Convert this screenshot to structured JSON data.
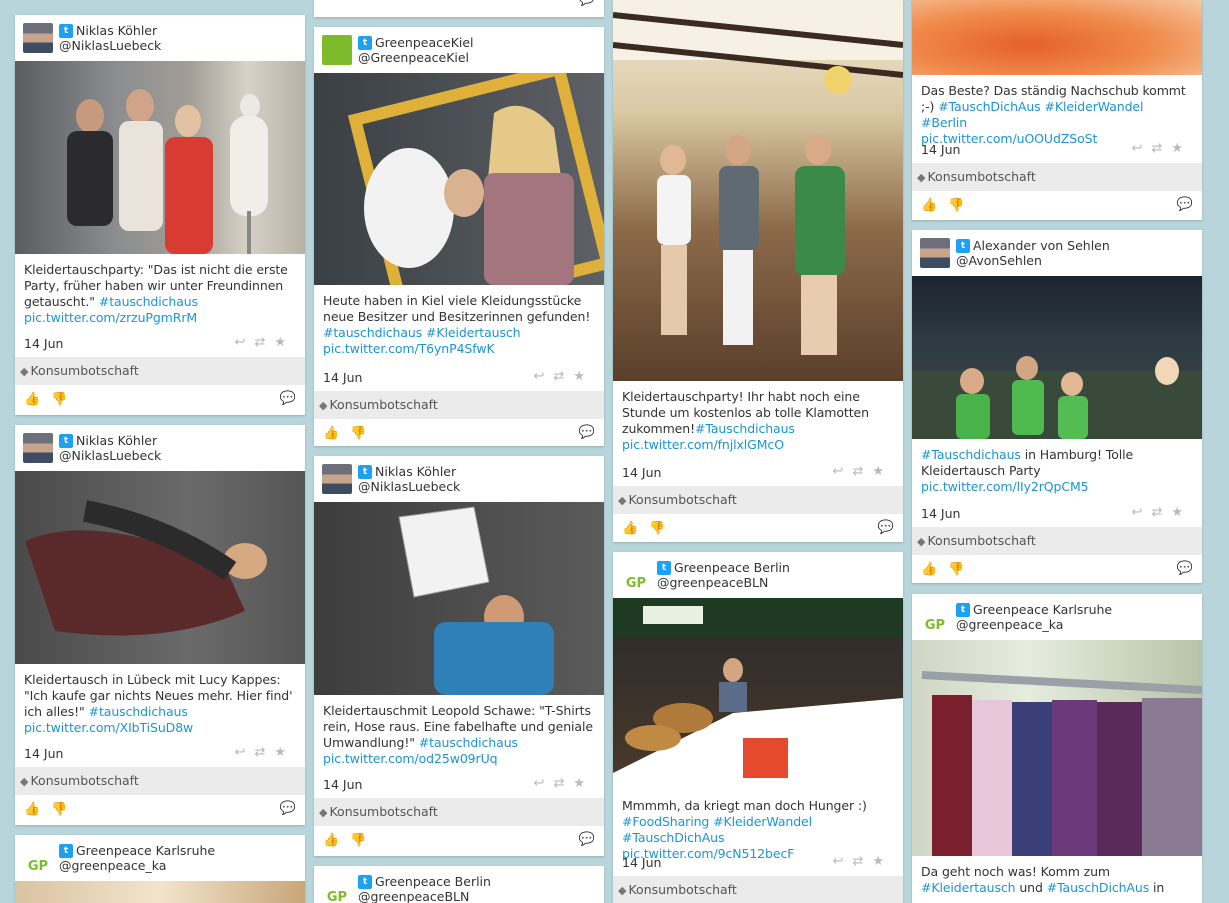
{
  "colors": {
    "background": "#b7d5da",
    "link": "#1b95d0",
    "tagbar": "#ebebeb",
    "twitter": "#1da1f2"
  },
  "icons": {
    "twitter": "twitter-icon",
    "tag": "tag-icon",
    "reply": "reply-icon",
    "retweet": "retweet-icon",
    "favorite": "star-icon",
    "like": "thumbs-up-icon",
    "dislike": "thumbs-down-icon",
    "comment": "comment-icon"
  },
  "tag_label": "Konsumbotschaft",
  "glyphs": {
    "tw": "t",
    "tag": "◆",
    "acts": "↩⇄★",
    "up": "👍",
    "down": "👎",
    "comment": "💬",
    "gp": "GP"
  },
  "posts": [
    {
      "user": "Niklas Köhler",
      "handle": "@NiklasLuebeck",
      "date": "14 Jun",
      "text": "Kleidertauschparty: \"Das ist nicht die erste Party, früher haben wir unter Freundinnen getauscht.\" ",
      "hashtags": "#tauschdichaus",
      "link": "pic.twitter.com/zrzuPgmRrM"
    },
    {
      "user": "Niklas Köhler",
      "handle": "@NiklasLuebeck",
      "date": "14 Jun",
      "text": "Kleidertausch in Lübeck mit Lucy Kappes: \"Ich kaufe gar nichts Neues mehr. Hier find' ich alles!\" ",
      "hashtags": "#tauschdichaus",
      "link": "pic.twitter.com/XIbTiSuD8w"
    },
    {
      "user": "Greenpeace Karlsruhe",
      "handle": "@greenpeace_ka"
    },
    {
      "user": "GreenpeaceKiel",
      "handle": "@GreenpeaceKiel",
      "date": "14 Jun",
      "text": "Heute haben in Kiel viele Kleidungsstücke neue Besitzer und Besitzerinnen gefunden! ",
      "hashtags": "#tauschdichaus #Kleidertausch",
      "link": "pic.twitter.com/T6ynP4SfwK"
    },
    {
      "user": "Niklas Köhler",
      "handle": "@NiklasLuebeck",
      "date": "14 Jun",
      "text": "Kleidertauschmit Leopold Schawe: \"T-Shirts rein, Hose raus. Eine fabelhafte und geniale Umwandlung!\" ",
      "hashtags": "#tauschdichaus",
      "link": "pic.twitter.com/od25w09rUq"
    },
    {
      "user": "Greenpeace Berlin",
      "handle": "@greenpeaceBLN"
    },
    {
      "date": "14 Jun",
      "text": "Kleidertauschparty! Ihr habt noch eine Stunde um kostenlos ab tolle Klamotten zukommen!",
      "hashtags": "#Tauschdichaus",
      "link": "pic.twitter.com/fnjlxlGMcO"
    },
    {
      "user": "Greenpeace Berlin",
      "handle": "@greenpeaceBLN",
      "date": "14 Jun",
      "text": "Mmmmh, da kriegt man doch Hunger :) ",
      "hashtags": "#FoodSharing #KleiderWandel #TauschDichAus",
      "link": "pic.twitter.com/9cN512becF"
    },
    {
      "date": "14 Jun",
      "text": "Das Beste? Das ständig Nachschub kommt ;-) ",
      "hashtags": "#TauschDichAus #KleiderWandel #Berlin",
      "link": "pic.twitter.com/uOOUdZSoSt"
    },
    {
      "user": "Alexander von Sehlen",
      "handle": "@AvonSehlen",
      "date": "14 Jun",
      "text": " in Hamburg! Tolle Kleidertausch Party",
      "hashtags": "#Tauschdichaus",
      "link": "pic.twitter.com/lIy2rQpCM5"
    },
    {
      "user": "Greenpeace Karlsruhe",
      "handle": "@greenpeace_ka",
      "text": "Da geht noch was! Komm zum ",
      "hashtags": "#Kleidertausch",
      "text2": " und ",
      "hashtags2": "#TauschDichAus",
      "text3": " in"
    }
  ]
}
